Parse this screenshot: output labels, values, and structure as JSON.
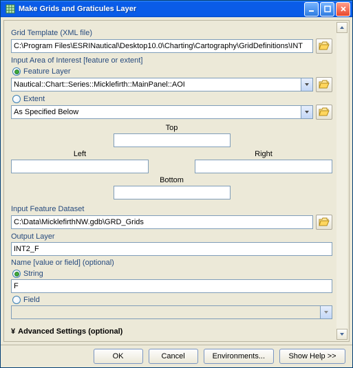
{
  "window": {
    "title": "Make Grids and Graticules Layer"
  },
  "labels": {
    "grid_template": "Grid Template (XML file)",
    "input_aoi": "Input Area of Interest [feature or extent]",
    "feature_layer": "Feature Layer",
    "extent": "Extent",
    "as_specified": "As Specified Below",
    "top": "Top",
    "left": "Left",
    "right": "Right",
    "bottom": "Bottom",
    "input_fds": "Input Feature Dataset",
    "output_layer": "Output Layer",
    "name_opt": "Name [value or field] (optional)",
    "string": "String",
    "field": "Field",
    "advanced": "Advanced Settings (optional)"
  },
  "values": {
    "grid_template": "C:\\Program Files\\ESRINautical\\Desktop10.0\\Charting\\Cartography\\GridDefinitions\\INT",
    "feature_layer": "Nautical::Chart::Series::Micklefirth::MainPanel::AOI",
    "input_fds": "C:\\Data\\MicklefirthNW.gdb\\GRD_Grids",
    "output_layer": "INT2_F",
    "name_string": "F",
    "top": "",
    "left": "",
    "right": "",
    "bottom": ""
  },
  "buttons": {
    "ok": "OK",
    "cancel": "Cancel",
    "env": "Environments...",
    "help": "Show Help >>"
  }
}
